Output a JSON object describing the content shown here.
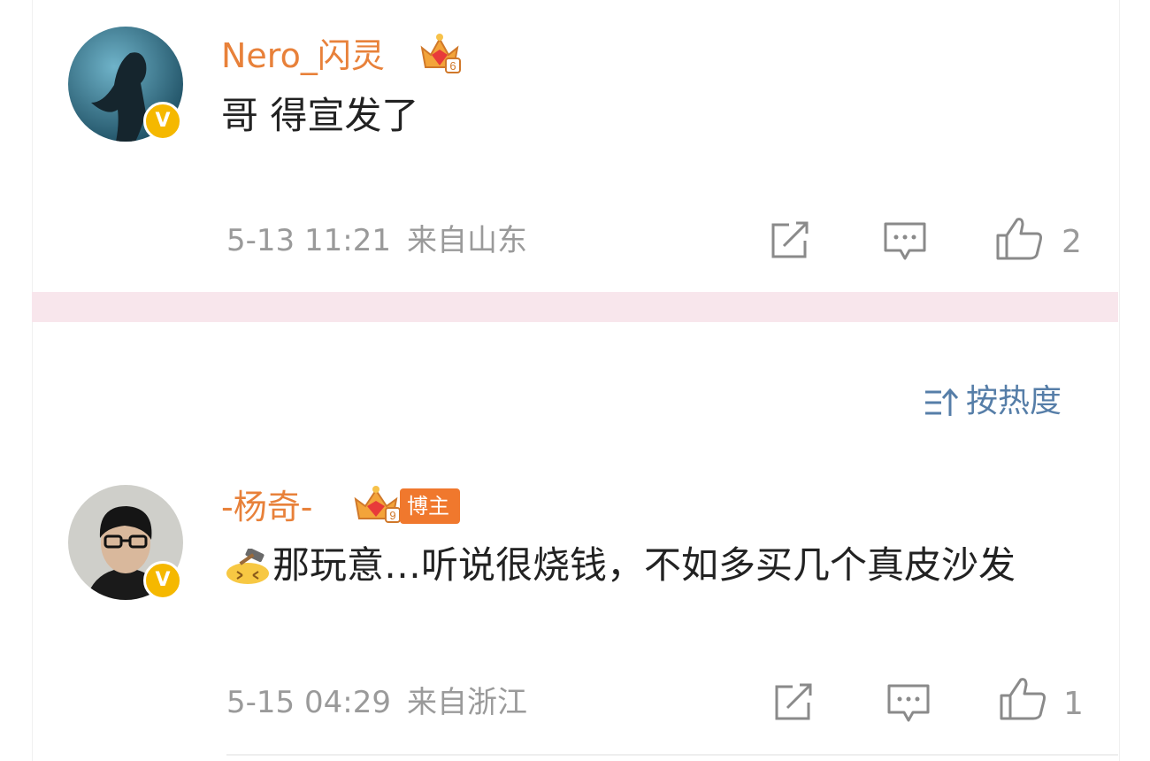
{
  "comments": [
    {
      "username": "Nero_闪灵",
      "crown_level": "6",
      "text": "哥 得宣发了",
      "date": "5-13 11:21",
      "location": "来自山东",
      "likes": "2",
      "verified_mark": "V",
      "icons": {
        "share": "share-icon",
        "comment": "comment-icon",
        "like": "thumbs-up-icon"
      }
    },
    {
      "username": "-杨奇-",
      "crown_level": "9",
      "tag": "博主",
      "text": "那玩意…听说很烧钱，不如多买几个真皮沙发",
      "date": "5-15 04:29",
      "location": "来自浙江",
      "likes": "1",
      "verified_mark": "V",
      "icons": {
        "share": "share-icon",
        "comment": "comment-icon",
        "like": "thumbs-up-icon"
      }
    }
  ],
  "sort": {
    "label": "按热度",
    "icon": "sort-icon"
  },
  "colors": {
    "username": "#e8813a",
    "verified": "#f5b800",
    "divider": "#f8e6ec",
    "sort": "#567ea8",
    "meta": "#9a9a9a"
  }
}
